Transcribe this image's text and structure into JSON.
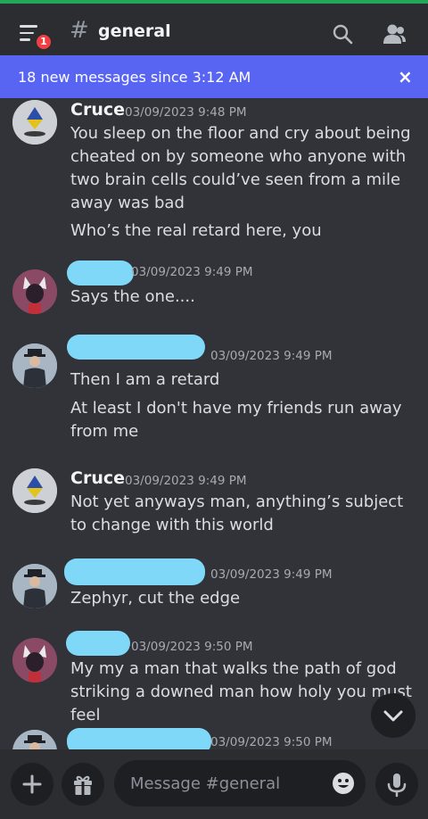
{
  "header": {
    "channel_hash": "#",
    "channel_name": "general",
    "badge_count": "1",
    "icons": [
      "menu-icon",
      "search-icon",
      "members-icon"
    ]
  },
  "banner": {
    "text": "18 new messages since 3:12 AM",
    "close": "×"
  },
  "messages": [
    {
      "author": "Cruce",
      "timestamp": "03/09/2023 9:48 PM",
      "lines": [
        "You sleep on the floor and cry about being cheated on by someone who anyone with two brain cells could’ve seen from a mile away was bad",
        "Who’s the real retard here, you"
      ]
    },
    {
      "author": "",
      "timestamp": "03/09/2023 9:49 PM",
      "lines": [
        "Says the one...."
      ]
    },
    {
      "author": "",
      "timestamp": "03/09/2023 9:49 PM",
      "lines": [
        "Then I am a retard",
        "At least I don't have my friends run away from me"
      ]
    },
    {
      "author": "Cruce",
      "timestamp": "03/09/2023 9:49 PM",
      "lines": [
        "Not yet anyways man, anything’s subject to change with this world"
      ]
    },
    {
      "author": "",
      "timestamp": "03/09/2023 9:49 PM",
      "lines": [
        "Zephyr, cut the edge"
      ]
    },
    {
      "author": "",
      "timestamp": "03/09/2023 9:50 PM",
      "lines": [
        "My my a man that walks the path of god striking a downed man how holy you must feel"
      ]
    },
    {
      "author": "",
      "timestamp": "03/09/2023 9:50 PM",
      "lines": []
    }
  ],
  "composer": {
    "placeholder": "Message #general"
  },
  "colors": {
    "background": "#313338",
    "header": "#2b2d31",
    "banner": "#5865f2",
    "redaction": "#7fd8f7",
    "badge": "#f23f43"
  }
}
